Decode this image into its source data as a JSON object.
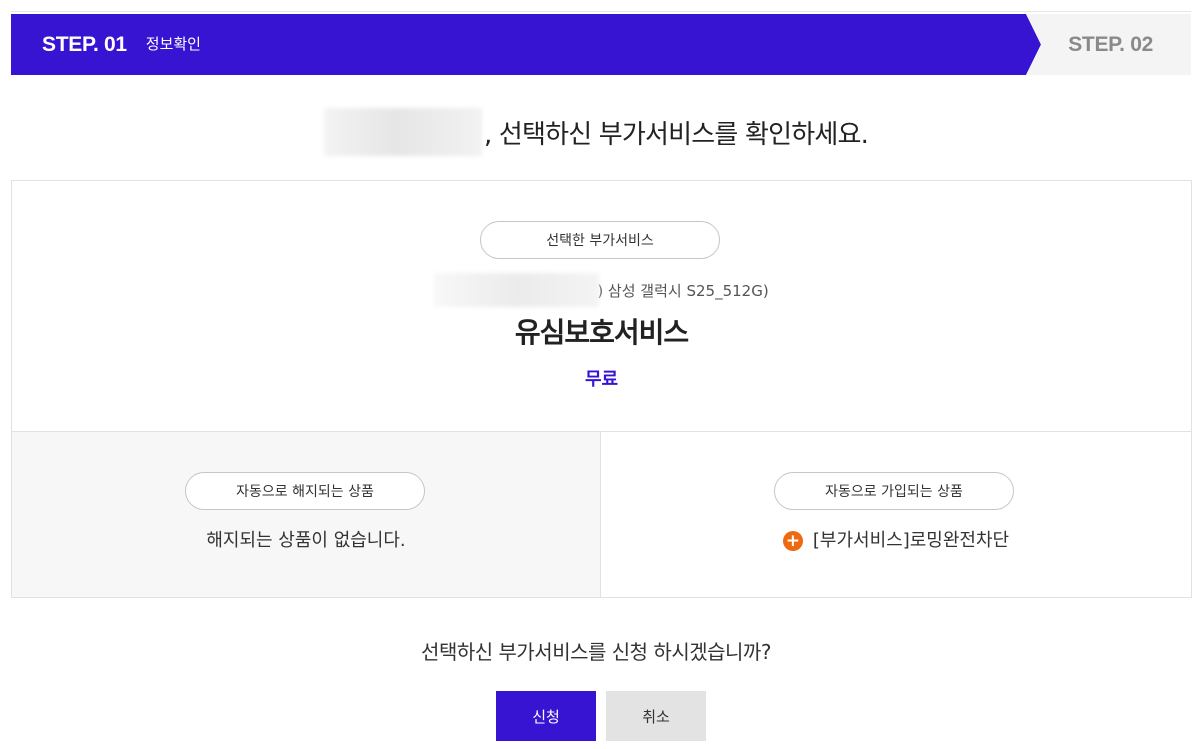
{
  "steps": {
    "step1_number": "STEP. 01",
    "step1_label": "정보확인",
    "step2_number": "STEP. 02"
  },
  "heading": {
    "text": ", 선택하신 부가서비스를 확인하세요."
  },
  "selected_service": {
    "section_label": "선택한 부가서비스",
    "device_text": ") 삼성 갤럭시 S25_512G)",
    "name": "유심보호서비스",
    "price": "무료"
  },
  "auto_cancel": {
    "section_label": "자동으로 해지되는 상품",
    "message": "해지되는 상품이 없습니다."
  },
  "auto_join": {
    "section_label": "자동으로 가입되는 상품",
    "icon": "plus-circle-icon",
    "item": "[부가서비스]로밍완전차단"
  },
  "confirm": {
    "question": "선택하신 부가서비스를 신청 하시겠습니까?",
    "apply_label": "신청",
    "cancel_label": "취소"
  },
  "colors": {
    "primary": "#3614d2",
    "accent_orange": "#ee6a10",
    "panel_gray": "#f7f7f7"
  }
}
